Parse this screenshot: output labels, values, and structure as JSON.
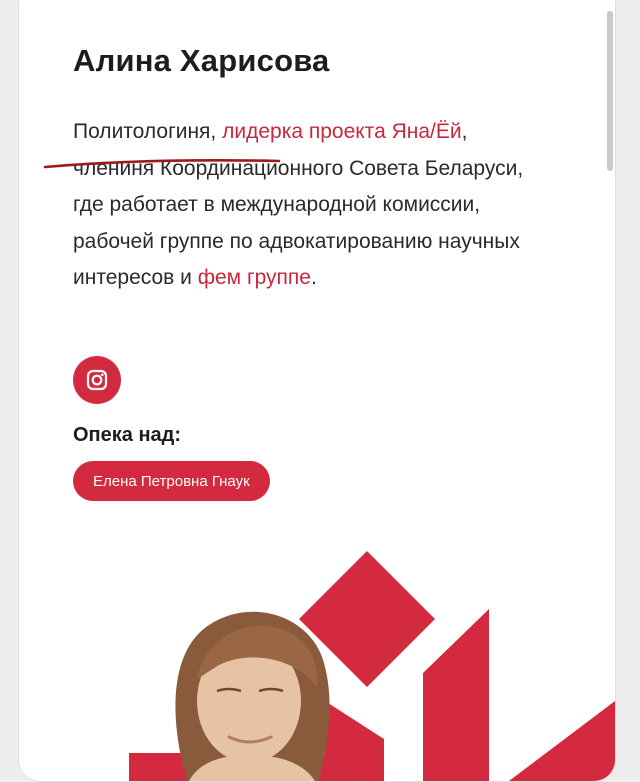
{
  "profile": {
    "name": "Алина Харисова",
    "bio": {
      "p1": "Политологиня, ",
      "link1": "лидерка проекта Яна/Ёй",
      "p2": ", члениня Координационного Совета Беларуси, где работает в международной комиссии, рабочей группе по адвокатированию научных интересов и ",
      "link2": "фем группе",
      "p3": "."
    }
  },
  "social": {
    "icon": "instagram-icon"
  },
  "guardianship": {
    "label": "Опека над:",
    "person": "Елена Петровна Гнаук"
  },
  "colors": {
    "accent": "#d32a3f",
    "link": "#c8283c",
    "text": "#2a2a2a"
  }
}
